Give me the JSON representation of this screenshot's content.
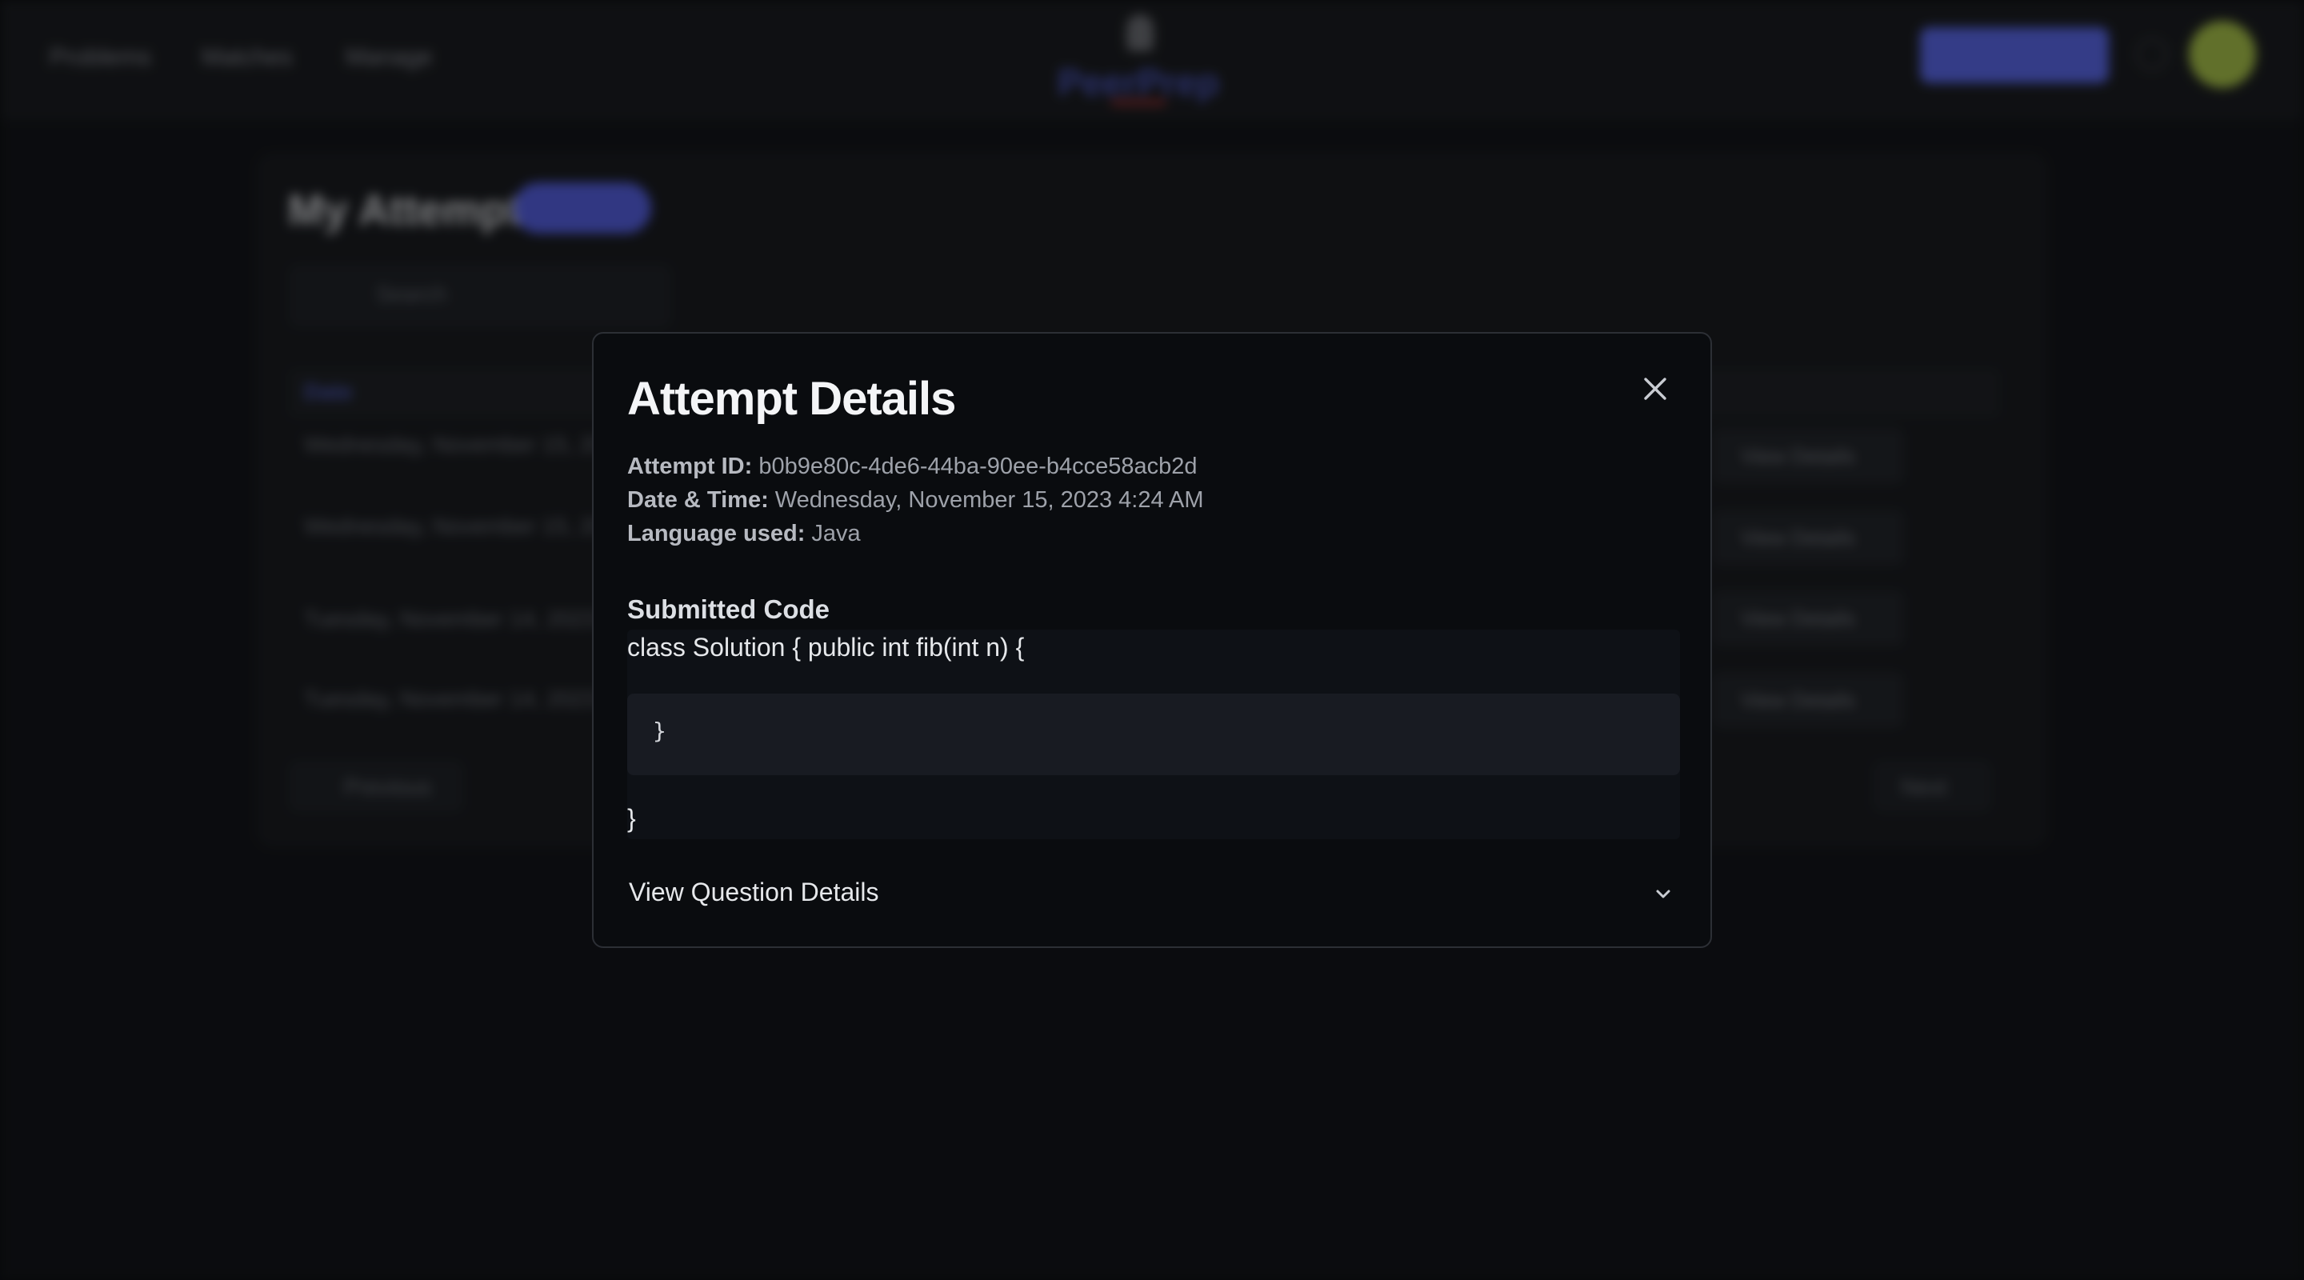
{
  "background": {
    "nav": {
      "links": [
        "Problems",
        "Matches",
        "Manage"
      ],
      "logo_text": "PeerPrep"
    },
    "attempts_card": {
      "title": "My Attempts",
      "search_placeholder": "Search",
      "column_header": "Date",
      "rows": [
        {
          "text": "Wednesday, November 15, 2023",
          "action": "View Details"
        },
        {
          "text": "Wednesday, November 15, 2023",
          "action": "View Details"
        },
        {
          "text": "Tuesday, November 14, 2023",
          "action": "View Details"
        },
        {
          "text": "Tuesday, November 14, 2023",
          "action": "View Details"
        }
      ],
      "pager": {
        "prev": "Previous",
        "next": "Next"
      }
    }
  },
  "modal": {
    "title": "Attempt Details",
    "attempt_id_label": "Attempt ID:",
    "attempt_id": "b0b9e80c-4de6-44ba-90ee-b4cce58acb2d",
    "datetime_label": "Date & Time:",
    "datetime": "Wednesday, November 15, 2023 4:24 AM",
    "language_label": "Language used:",
    "language": "Java",
    "code_section_label": "Submitted Code",
    "code_lines": {
      "first": "class Solution { public int fib(int n) {",
      "inner": "}",
      "last": "}"
    },
    "accordion_label": "View Question Details"
  },
  "colors": {
    "accent": "#5a68e8",
    "avatar": "#a8c24a",
    "modal_bg": "#0a0c0f",
    "overlay": "#000000"
  },
  "icons": {
    "close": "close-icon",
    "chevron": "chevron-down-icon",
    "search": "search-icon",
    "bell": "bell-icon"
  }
}
